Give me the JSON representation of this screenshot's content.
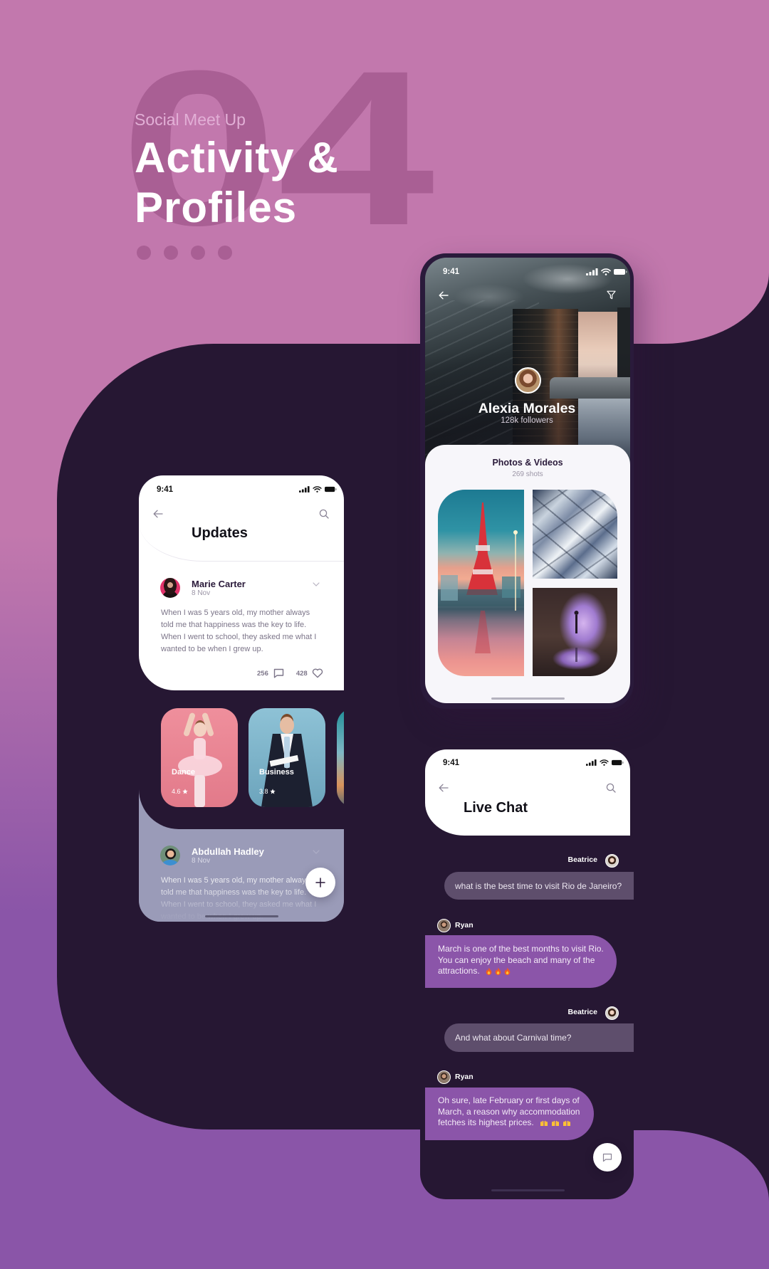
{
  "hero": {
    "number": "04",
    "subtitle": "Social Meet Up",
    "title_lines": [
      "Activity &",
      "Profiles"
    ],
    "page_dots": 4
  },
  "profile_screen": {
    "status_time": "9:41",
    "name": "Alexia Morales",
    "followers": "128k followers",
    "media": {
      "title": "Photos & Videos",
      "count": "269 shots"
    }
  },
  "updates_screen": {
    "status_time": "9:41",
    "title": "Updates",
    "posts": [
      {
        "author": "Marie Carter",
        "date": "8 Nov",
        "body_lines": [
          "When I was 5 years old, my mother always",
          "told me that happiness was the key to life.",
          "When I went to school, they asked me what I",
          "wanted to be when I grew up."
        ],
        "comment_count": "256",
        "like_count": "428"
      },
      {
        "author": "Abdullah Hadley",
        "date": "8 Nov",
        "body_lines": [
          "When I was 5 years old, my mother always",
          "told me that happiness was the key to life.",
          "When I went to school, they asked me what I",
          "wanted to be when I grew up."
        ]
      }
    ],
    "categories": [
      {
        "label": "Dance",
        "rating": "4.6"
      },
      {
        "label": "Business",
        "rating": "3.8"
      }
    ],
    "fab_label": "+"
  },
  "chat_screen": {
    "status_time": "9:41",
    "title": "Live Chat",
    "messages": [
      {
        "sender": "Beatrice",
        "side": "right",
        "lines": [
          "what is the best time to visit Rio de Janeiro?"
        ]
      },
      {
        "sender": "Ryan",
        "side": "left",
        "lines": [
          "March is one of the best months to visit Rio.",
          "You can enjoy the beach and many of the",
          "attractions."
        ],
        "emoji": [
          "🔥",
          "🔥",
          "🔥"
        ]
      },
      {
        "sender": "Beatrice",
        "side": "right",
        "lines": [
          "And what about Carnival time?"
        ]
      },
      {
        "sender": "Ryan",
        "side": "left",
        "lines": [
          "Oh sure, late February or first days of",
          "March, a reason why accommodation",
          "fetches its highest  prices."
        ],
        "emoji": [
          "🙌",
          "🙌",
          "🙌"
        ]
      }
    ]
  },
  "icons": [
    "arrow-left-icon",
    "filter-icon",
    "search-icon",
    "chevron-down-icon",
    "comment-icon",
    "heart-icon",
    "star-icon",
    "plus-icon",
    "chat-bubble-icon",
    "signal-icon",
    "wifi-icon",
    "battery-icon"
  ],
  "colors": {
    "background_pink": "#c278ad",
    "background_purple": "#8a55a8",
    "panel_dark": "#261733",
    "hero_number": "#a95f94",
    "bubble_incoming": "#8b55a9",
    "bubble_outgoing": "#5e4e6c",
    "lavender_panel": "#9a9bb8"
  }
}
